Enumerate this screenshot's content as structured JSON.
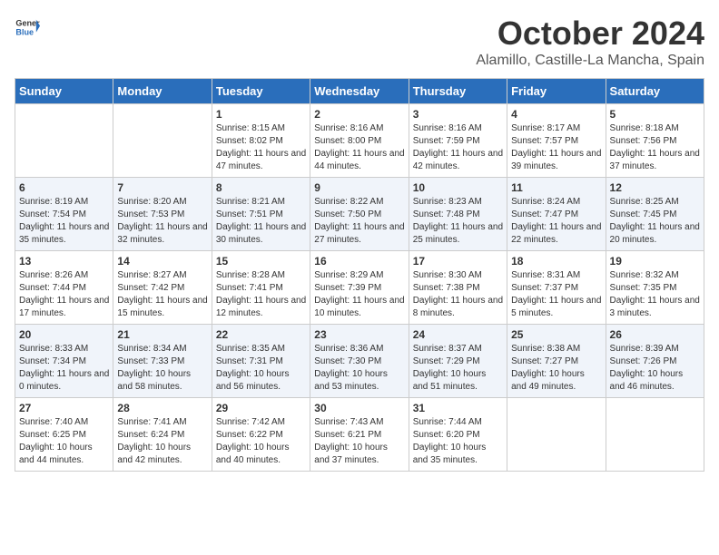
{
  "header": {
    "logo_general": "General",
    "logo_blue": "Blue",
    "month": "October 2024",
    "location": "Alamillo, Castille-La Mancha, Spain"
  },
  "days_of_week": [
    "Sunday",
    "Monday",
    "Tuesday",
    "Wednesday",
    "Thursday",
    "Friday",
    "Saturday"
  ],
  "weeks": [
    [
      {
        "day": "",
        "content": ""
      },
      {
        "day": "",
        "content": ""
      },
      {
        "day": "1",
        "content": "Sunrise: 8:15 AM\nSunset: 8:02 PM\nDaylight: 11 hours and 47 minutes."
      },
      {
        "day": "2",
        "content": "Sunrise: 8:16 AM\nSunset: 8:00 PM\nDaylight: 11 hours and 44 minutes."
      },
      {
        "day": "3",
        "content": "Sunrise: 8:16 AM\nSunset: 7:59 PM\nDaylight: 11 hours and 42 minutes."
      },
      {
        "day": "4",
        "content": "Sunrise: 8:17 AM\nSunset: 7:57 PM\nDaylight: 11 hours and 39 minutes."
      },
      {
        "day": "5",
        "content": "Sunrise: 8:18 AM\nSunset: 7:56 PM\nDaylight: 11 hours and 37 minutes."
      }
    ],
    [
      {
        "day": "6",
        "content": "Sunrise: 8:19 AM\nSunset: 7:54 PM\nDaylight: 11 hours and 35 minutes."
      },
      {
        "day": "7",
        "content": "Sunrise: 8:20 AM\nSunset: 7:53 PM\nDaylight: 11 hours and 32 minutes."
      },
      {
        "day": "8",
        "content": "Sunrise: 8:21 AM\nSunset: 7:51 PM\nDaylight: 11 hours and 30 minutes."
      },
      {
        "day": "9",
        "content": "Sunrise: 8:22 AM\nSunset: 7:50 PM\nDaylight: 11 hours and 27 minutes."
      },
      {
        "day": "10",
        "content": "Sunrise: 8:23 AM\nSunset: 7:48 PM\nDaylight: 11 hours and 25 minutes."
      },
      {
        "day": "11",
        "content": "Sunrise: 8:24 AM\nSunset: 7:47 PM\nDaylight: 11 hours and 22 minutes."
      },
      {
        "day": "12",
        "content": "Sunrise: 8:25 AM\nSunset: 7:45 PM\nDaylight: 11 hours and 20 minutes."
      }
    ],
    [
      {
        "day": "13",
        "content": "Sunrise: 8:26 AM\nSunset: 7:44 PM\nDaylight: 11 hours and 17 minutes."
      },
      {
        "day": "14",
        "content": "Sunrise: 8:27 AM\nSunset: 7:42 PM\nDaylight: 11 hours and 15 minutes."
      },
      {
        "day": "15",
        "content": "Sunrise: 8:28 AM\nSunset: 7:41 PM\nDaylight: 11 hours and 12 minutes."
      },
      {
        "day": "16",
        "content": "Sunrise: 8:29 AM\nSunset: 7:39 PM\nDaylight: 11 hours and 10 minutes."
      },
      {
        "day": "17",
        "content": "Sunrise: 8:30 AM\nSunset: 7:38 PM\nDaylight: 11 hours and 8 minutes."
      },
      {
        "day": "18",
        "content": "Sunrise: 8:31 AM\nSunset: 7:37 PM\nDaylight: 11 hours and 5 minutes."
      },
      {
        "day": "19",
        "content": "Sunrise: 8:32 AM\nSunset: 7:35 PM\nDaylight: 11 hours and 3 minutes."
      }
    ],
    [
      {
        "day": "20",
        "content": "Sunrise: 8:33 AM\nSunset: 7:34 PM\nDaylight: 11 hours and 0 minutes."
      },
      {
        "day": "21",
        "content": "Sunrise: 8:34 AM\nSunset: 7:33 PM\nDaylight: 10 hours and 58 minutes."
      },
      {
        "day": "22",
        "content": "Sunrise: 8:35 AM\nSunset: 7:31 PM\nDaylight: 10 hours and 56 minutes."
      },
      {
        "day": "23",
        "content": "Sunrise: 8:36 AM\nSunset: 7:30 PM\nDaylight: 10 hours and 53 minutes."
      },
      {
        "day": "24",
        "content": "Sunrise: 8:37 AM\nSunset: 7:29 PM\nDaylight: 10 hours and 51 minutes."
      },
      {
        "day": "25",
        "content": "Sunrise: 8:38 AM\nSunset: 7:27 PM\nDaylight: 10 hours and 49 minutes."
      },
      {
        "day": "26",
        "content": "Sunrise: 8:39 AM\nSunset: 7:26 PM\nDaylight: 10 hours and 46 minutes."
      }
    ],
    [
      {
        "day": "27",
        "content": "Sunrise: 7:40 AM\nSunset: 6:25 PM\nDaylight: 10 hours and 44 minutes."
      },
      {
        "day": "28",
        "content": "Sunrise: 7:41 AM\nSunset: 6:24 PM\nDaylight: 10 hours and 42 minutes."
      },
      {
        "day": "29",
        "content": "Sunrise: 7:42 AM\nSunset: 6:22 PM\nDaylight: 10 hours and 40 minutes."
      },
      {
        "day": "30",
        "content": "Sunrise: 7:43 AM\nSunset: 6:21 PM\nDaylight: 10 hours and 37 minutes."
      },
      {
        "day": "31",
        "content": "Sunrise: 7:44 AM\nSunset: 6:20 PM\nDaylight: 10 hours and 35 minutes."
      },
      {
        "day": "",
        "content": ""
      },
      {
        "day": "",
        "content": ""
      }
    ]
  ]
}
